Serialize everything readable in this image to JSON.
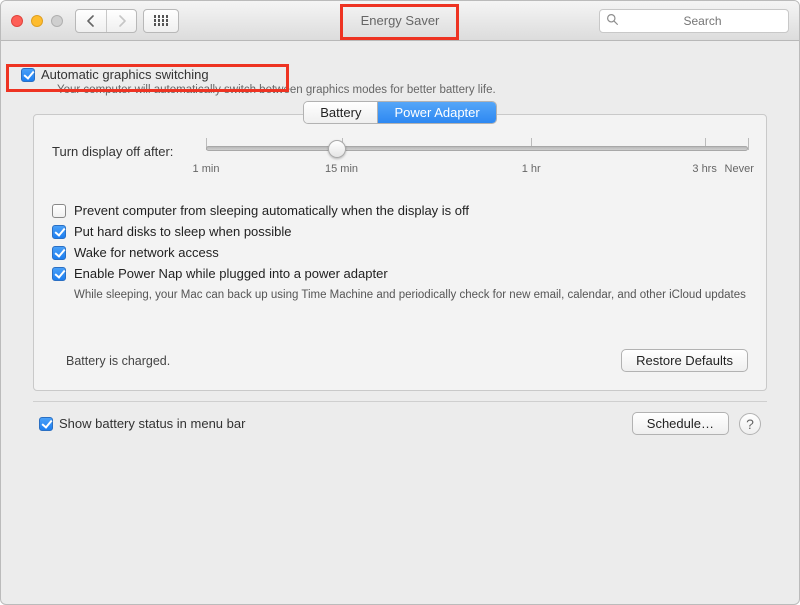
{
  "window": {
    "title": "Energy Saver"
  },
  "search": {
    "placeholder": "Search"
  },
  "auto_graphics": {
    "label": "Automatic graphics switching",
    "subtext": "Your computer will automatically switch between graphics modes for better battery life.",
    "checked": true
  },
  "tabs": {
    "battery": "Battery",
    "adapter": "Power Adapter",
    "active": "adapter"
  },
  "slider": {
    "label": "Turn display off after:",
    "ticks": {
      "min": "1 min",
      "mid1": "15 min",
      "mid2": "1 hr",
      "end1": "3 hrs",
      "never": "Never"
    }
  },
  "options": {
    "prevent_sleep": {
      "label": "Prevent computer from sleeping automatically when the display is off",
      "checked": false
    },
    "hard_disks": {
      "label": "Put hard disks to sleep when possible",
      "checked": true
    },
    "wake_network": {
      "label": "Wake for network access",
      "checked": true
    },
    "power_nap": {
      "label": "Enable Power Nap while plugged into a power adapter",
      "checked": true,
      "sub": "While sleeping, your Mac can back up using Time Machine and periodically check for new email, calendar, and other iCloud updates"
    }
  },
  "status": "Battery is charged.",
  "buttons": {
    "restore": "Restore Defaults",
    "schedule": "Schedule…"
  },
  "menu_bar": {
    "label": "Show battery status in menu bar",
    "checked": true
  }
}
